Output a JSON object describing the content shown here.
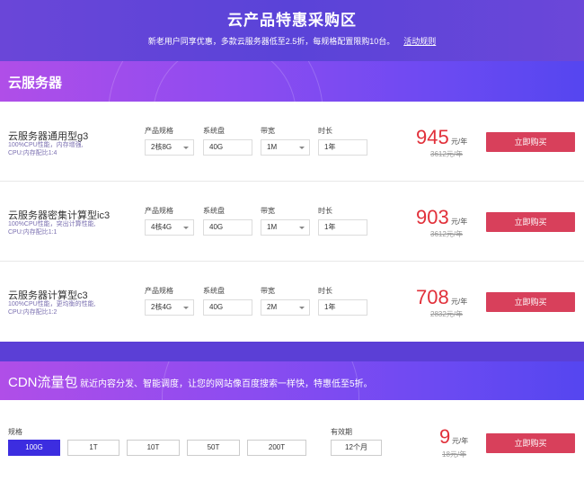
{
  "header": {
    "title": "云产品特惠采购区",
    "subtitle": "新老用户同享优惠，多款云服务器低至2.5折，每规格配置限购10台。",
    "rules_link": "活动规则"
  },
  "server_section": {
    "title": "云服务器",
    "labels": {
      "spec": "产品规格",
      "disk": "系统盘",
      "bandwidth": "带宽",
      "duration": "时长"
    },
    "unit": "元/年",
    "buy_label": "立即购买",
    "products": [
      {
        "name": "云服务器通用型g3",
        "line1": "100%CPU性能，内存增强,",
        "line2": "CPU:内存配比1:4",
        "spec": "2核8G",
        "disk": "40G",
        "bandwidth": "1M",
        "duration": "1年",
        "price": "945",
        "original": "3612元/年"
      },
      {
        "name": "云服务器密集计算型ic3",
        "line1": "100%CPU性能，突出计算性能,",
        "line2": "CPU:内存配比1:1",
        "spec": "4核4G",
        "disk": "40G",
        "bandwidth": "1M",
        "duration": "1年",
        "price": "903",
        "original": "3612元/年"
      },
      {
        "name": "云服务器计算型c3",
        "line1": "100%CPU性能，更均衡的性能,",
        "line2": "CPU:内存配比1:2",
        "spec": "2核4G",
        "disk": "40G",
        "bandwidth": "2M",
        "duration": "1年",
        "price": "708",
        "original": "2832元/年"
      }
    ]
  },
  "cdn_section": {
    "title": "CDN流量包",
    "desc": "就近内容分发、智能调度，让您的网站像百度搜索一样快，特惠低至5折。",
    "spec_label": "规格",
    "validity_label": "有效期",
    "options": [
      "100G",
      "1T",
      "10T",
      "50T",
      "200T"
    ],
    "selected": "100G",
    "validity": "12个月",
    "price": "9",
    "unit": "元/年",
    "original": "18元/年",
    "buy_label": "立即购买"
  }
}
